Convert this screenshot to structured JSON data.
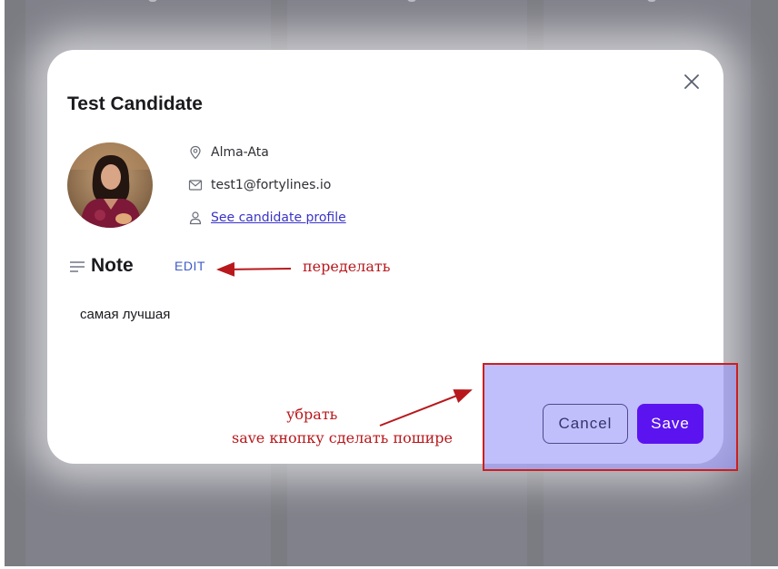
{
  "modal": {
    "title": "Test Candidate",
    "location": "Alma-Ata",
    "email": "test1@fortylines.io",
    "profile_link": "See candidate profile",
    "note_heading": "Note",
    "edit_label": "EDIT",
    "note_text": "самая лучшая",
    "cancel_label": "Cancel",
    "save_label": "Save"
  },
  "annotations": {
    "redo": "переделать",
    "remove": "убрать",
    "widen_save": "save кнопку сделать пошире"
  },
  "icons": {
    "close": "close-icon",
    "location": "location-pin-icon",
    "email": "envelope-icon",
    "profile": "person-icon",
    "note": "text-lines-icon"
  },
  "colors": {
    "accent": "#5b14f0",
    "link": "#3a34c7",
    "edit": "#3d5cc7",
    "annotation": "#b8181c",
    "highlight": "#9b96fa"
  }
}
